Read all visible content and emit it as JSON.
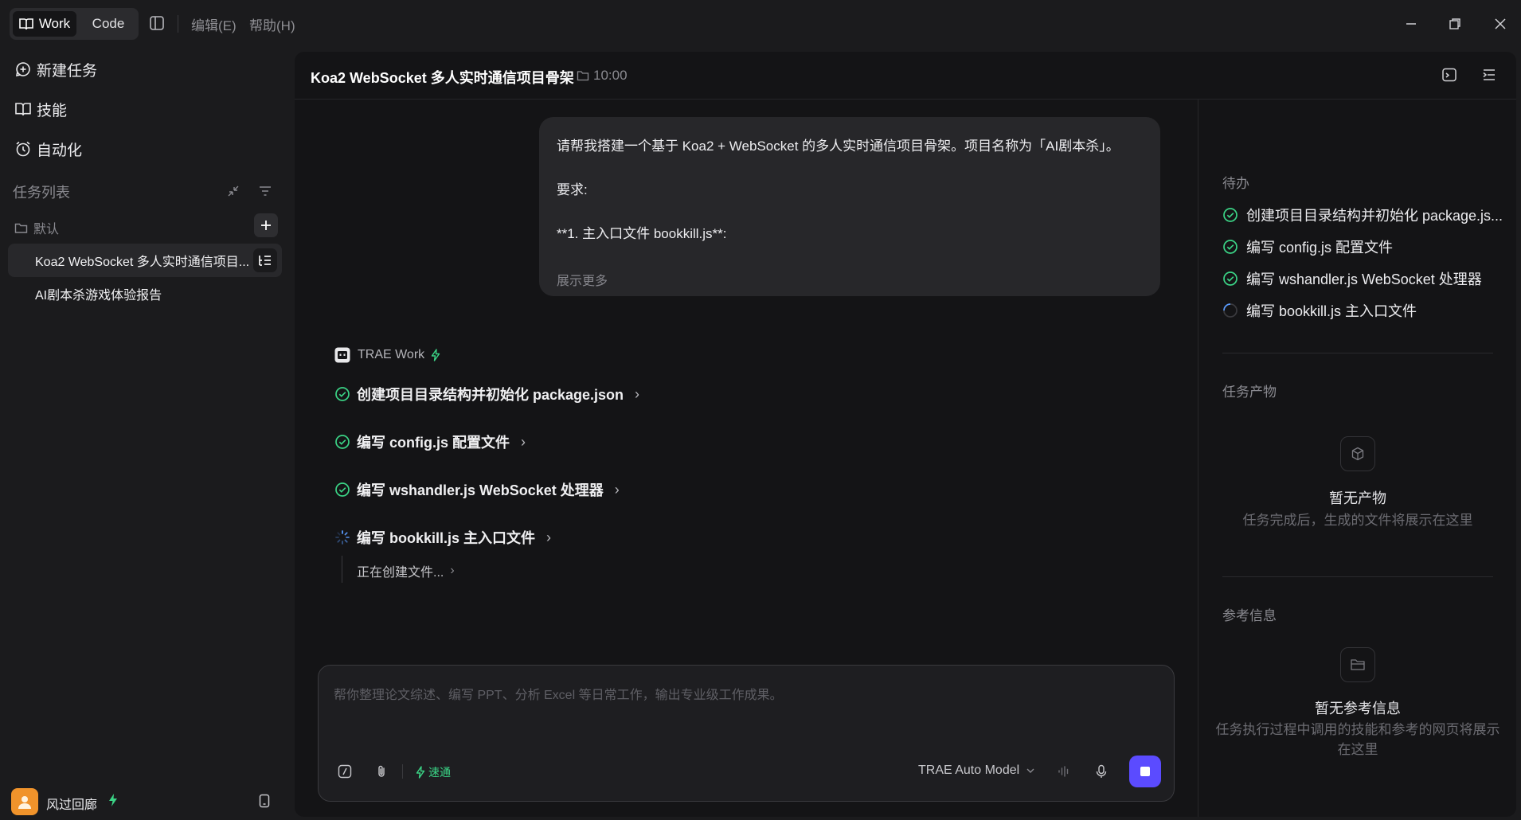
{
  "titlebar": {
    "mode_work": "Work",
    "mode_code": "Code",
    "menu_edit": "编辑(E)",
    "menu_help": "帮助(H)"
  },
  "sidebar": {
    "new_task": "新建任务",
    "skills": "技能",
    "automation": "自动化",
    "task_list_title": "任务列表",
    "group_default": "默认",
    "tasks": [
      {
        "label": "Koa2 WebSocket 多人实时通信项目..."
      },
      {
        "label": "AI剧本杀游戏体验报告"
      }
    ],
    "user_name": "风过回廊"
  },
  "main": {
    "title": "Koa2 WebSocket 多人实时通信项目骨架",
    "time": "10:00",
    "message": {
      "line1": "请帮我搭建一个基于 Koa2 + WebSocket 的多人实时通信项目骨架。项目名称为「AI剧本杀」。",
      "line2": "要求:",
      "line3": "**1. 主入口文件 bookkill.js**:",
      "show_more": "展示更多"
    },
    "agent_name": "TRAE Work",
    "steps": [
      {
        "label": "创建项目目录结构并初始化 package.json",
        "status": "done"
      },
      {
        "label": "编写 config.js 配置文件",
        "status": "done"
      },
      {
        "label": "编写 wshandler.js WebSocket 处理器",
        "status": "done"
      },
      {
        "label": "编写 bookkill.js 主入口文件",
        "status": "running"
      }
    ],
    "substep": "正在创建文件...",
    "composer": {
      "placeholder": "帮你整理论文综述、编写 PPT、分析 Excel 等日常工作，输出专业级工作成果。",
      "speed_label": "速通",
      "model": "TRAE Auto Model"
    }
  },
  "right_panel": {
    "todo_title": "待办",
    "todos": [
      {
        "label": "创建项目目录结构并初始化 package.js...",
        "status": "done"
      },
      {
        "label": "编写 config.js 配置文件",
        "status": "done"
      },
      {
        "label": "编写 wshandler.js WebSocket 处理器",
        "status": "done"
      },
      {
        "label": "编写 bookkill.js 主入口文件",
        "status": "running"
      }
    ],
    "artifacts_title": "任务产物",
    "artifacts_empty_title": "暂无产物",
    "artifacts_empty_sub": "任务完成后，生成的文件将展示在这里",
    "reference_title": "参考信息",
    "reference_empty_title": "暂无参考信息",
    "reference_empty_sub": "任务执行过程中调用的技能和参考的网页将展示在这里"
  },
  "colors": {
    "accent_green": "#3bd486",
    "accent_purple": "#5b4bff",
    "avatar_orange": "#f0932b"
  }
}
